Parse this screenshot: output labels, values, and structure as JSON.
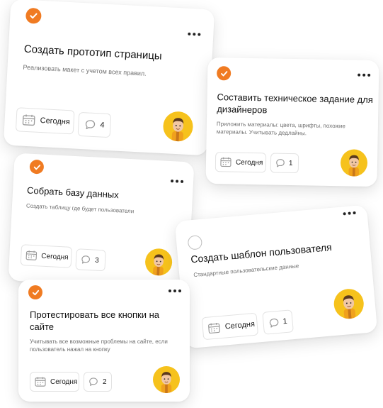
{
  "cards": [
    {
      "title": "Создать прототип страницы",
      "description": "Реализовать макет с учетом всех правил.",
      "date_label": "Сегодня",
      "comments": "4",
      "completed": true
    },
    {
      "title": "Составить техническое задание для дизайнеров",
      "description": "Приложить материалы: цвета, шрифты, похожие материалы. Учитывать дедлайны.",
      "date_label": "Сегодня",
      "comments": "1",
      "completed": true
    },
    {
      "title": "Собрать базу данных",
      "description": "Создать таблицу где будет пользователи",
      "date_label": "Сегодня",
      "comments": "3",
      "completed": true
    },
    {
      "title": "Создать шаблон пользователя",
      "description": "Стандартные пользовательские данные",
      "date_label": "Сегодня",
      "comments": "1",
      "completed": false
    },
    {
      "title": "Протестировать все кнопки на сайте",
      "description": "Учитывать все возможные проблемы на сайте, если пользователь нажал на кнопку",
      "date_label": "Сегодня",
      "comments": "2",
      "completed": true
    }
  ],
  "colors": {
    "accent": "#f07b22",
    "avatar_bg": "#f6c21c"
  },
  "icons": {
    "check": "check-icon",
    "more": "more-icon",
    "calendar": "calendar-icon",
    "comment": "comment-icon"
  }
}
